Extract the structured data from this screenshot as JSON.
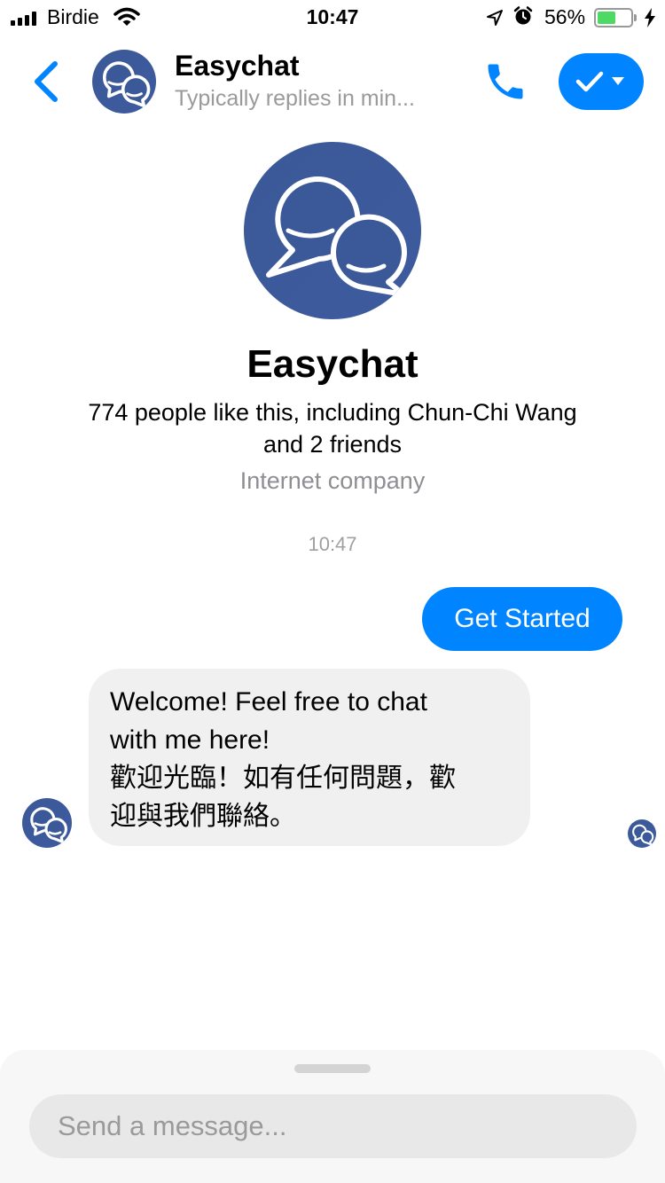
{
  "status_bar": {
    "carrier": "Birdie",
    "time": "10:47",
    "battery_percent_label": "56%",
    "battery_level": 0.56
  },
  "header": {
    "title": "Easychat",
    "subtitle": "Typically replies in min..."
  },
  "profile": {
    "name": "Easychat",
    "likes_line1": "774 people like this, including Chun-Chi Wang",
    "likes_line2": "and 2 friends",
    "category": "Internet company"
  },
  "conversation": {
    "timestamp": "10:47",
    "outgoing": {
      "text": "Get Started"
    },
    "incoming": {
      "lines": [
        "Welcome! Feel free to chat",
        "with me here!",
        "歡迎光臨！如有任何問題，歡",
        "迎與我們聯絡。"
      ]
    }
  },
  "composer": {
    "placeholder": "Send a message..."
  },
  "colors": {
    "accent": "#0084ff",
    "brand_avatar": "#3b5998",
    "bubble_in": "#f0f0f0",
    "battery_fill": "#4cd964"
  },
  "icons": {
    "back": "chevron-left-icon",
    "call": "phone-icon",
    "done": "check-icon",
    "menu": "caret-down-icon",
    "avatar": "chat-bubbles-icon"
  }
}
